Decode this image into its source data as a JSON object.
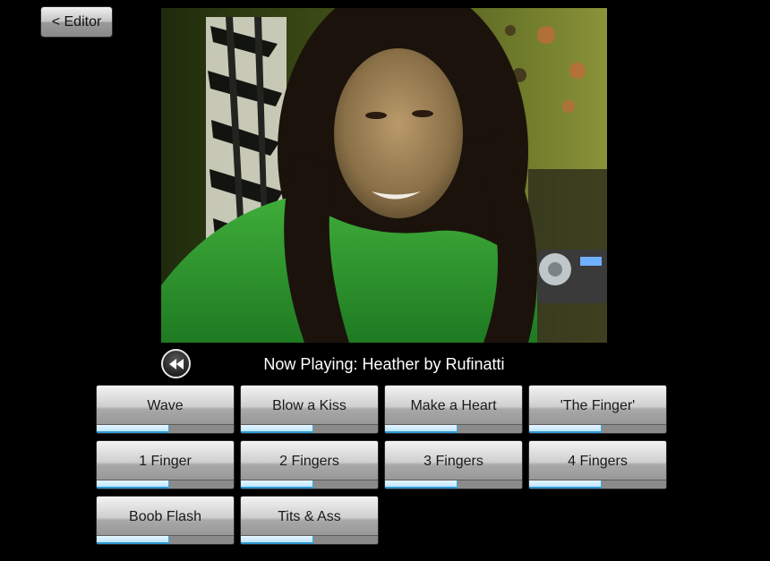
{
  "toolbar": {
    "editor_label": "< Editor"
  },
  "player": {
    "now_playing": "Now Playing: Heather by Rufinatti",
    "rewind_icon": "rewind-icon"
  },
  "actions": [
    {
      "label": "Wave",
      "progress": 0.53
    },
    {
      "label": "Blow a Kiss",
      "progress": 0.53
    },
    {
      "label": "Make a Heart",
      "progress": 0.53
    },
    {
      "label": "'The Finger'",
      "progress": 0.53
    },
    {
      "label": "1 Finger",
      "progress": 0.53
    },
    {
      "label": "2 Fingers",
      "progress": 0.53
    },
    {
      "label": "3 Fingers",
      "progress": 0.53
    },
    {
      "label": "4 Fingers",
      "progress": 0.53
    },
    {
      "label": "Boob Flash",
      "progress": 0.53
    },
    {
      "label": "Tits & Ass",
      "progress": 0.53
    }
  ],
  "colors": {
    "background": "#000000",
    "progress_accent": "#2e9ad6",
    "progress_fill": "#bfe6fb",
    "text_light": "#ffffff"
  }
}
